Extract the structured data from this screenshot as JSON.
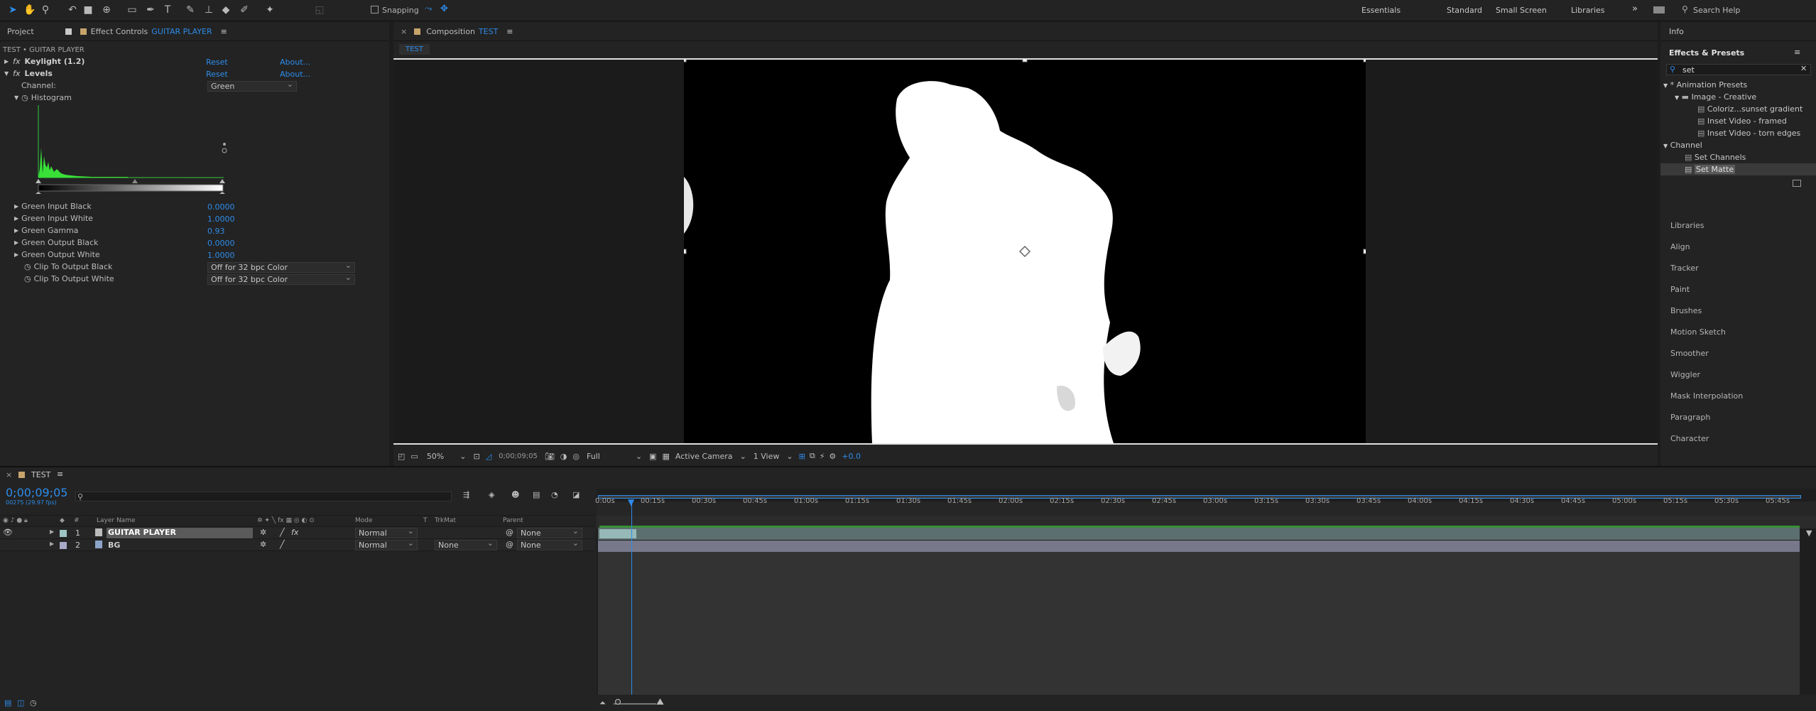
{
  "toolbar": {
    "snapping_label": "Snapping",
    "workspaces": [
      "Essentials",
      "Standard",
      "Small Screen",
      "Libraries"
    ],
    "search_placeholder": "Search Help"
  },
  "left_panel": {
    "tab_project": "Project",
    "tab_effect_controls": "Effect Controls",
    "effect_layer": "GUITAR PLAYER",
    "breadcrumb": "TEST • GUITAR PLAYER",
    "effects": [
      {
        "name": "Keylight (1.2)",
        "reset": "Reset",
        "about": "About..."
      },
      {
        "name": "Levels",
        "reset": "Reset",
        "about": "About..."
      }
    ],
    "channel_label": "Channel:",
    "channel_value": "Green",
    "histogram_label": "Histogram",
    "params": [
      {
        "label": "Green Input Black",
        "value": "0.0000"
      },
      {
        "label": "Green Input White",
        "value": "1.0000"
      },
      {
        "label": "Green Gamma",
        "value": "0.93"
      },
      {
        "label": "Green Output Black",
        "value": "0.0000"
      },
      {
        "label": "Green Output White",
        "value": "1.0000"
      }
    ],
    "clip_black_label": "Clip To Output Black",
    "clip_black_value": "Off for 32 bpc Color",
    "clip_white_label": "Clip To Output White",
    "clip_white_value": "Off for 32 bpc Color"
  },
  "comp_panel": {
    "title": "Composition",
    "comp_name": "TEST",
    "tab": "TEST",
    "zoom": "50%",
    "timecode": "0;00;09;05",
    "resolution": "Full",
    "camera": "Active Camera",
    "views": "1 View",
    "exposure": "+0.0"
  },
  "right_panel": {
    "info": "Info",
    "effects_presets": "Effects & Presets",
    "search_value": "set",
    "tree": [
      {
        "label": "* Animation Presets",
        "level": 0
      },
      {
        "label": "Image - Creative",
        "level": 1
      },
      {
        "label": "Coloriz...sunset gradient",
        "level": 2
      },
      {
        "label": "Inset Video - framed",
        "level": 2
      },
      {
        "label": "Inset Video - torn edges",
        "level": 2
      },
      {
        "label": "Channel",
        "level": 0
      },
      {
        "label": "Set Channels",
        "level": 1
      },
      {
        "label": "Set Matte",
        "level": 1
      }
    ],
    "panels": [
      "Libraries",
      "Align",
      "Tracker",
      "Paint",
      "Brushes",
      "Motion Sketch",
      "Smoother",
      "Wiggler",
      "Mask Interpolation",
      "Paragraph",
      "Character"
    ]
  },
  "timeline": {
    "tab": "TEST",
    "timecode": "0;00;09;05",
    "fps_info": "00275 (29.97 fps)",
    "columns": {
      "layer_name": "Layer Name",
      "mode": "Mode",
      "t": "T",
      "trkmat": "TrkMat",
      "parent": "Parent"
    },
    "layers": [
      {
        "num": "1",
        "name": "GUITAR PLAYER",
        "mode": "Normal",
        "trkmat": "",
        "parent": "None"
      },
      {
        "num": "2",
        "name": "BG",
        "mode": "Normal",
        "trkmat": "None",
        "parent": "None"
      }
    ],
    "ticks": [
      "0:00s",
      "00:15s",
      "00:30s",
      "00:45s",
      "01:00s",
      "01:15s",
      "01:30s",
      "01:45s",
      "02:00s",
      "02:15s",
      "02:30s",
      "02:45s",
      "03:00s",
      "03:15s",
      "03:30s",
      "03:45s",
      "04:00s",
      "04:15s",
      "04:30s",
      "04:45s",
      "05:00s",
      "05:15s",
      "05:30s",
      "05:45s"
    ]
  }
}
